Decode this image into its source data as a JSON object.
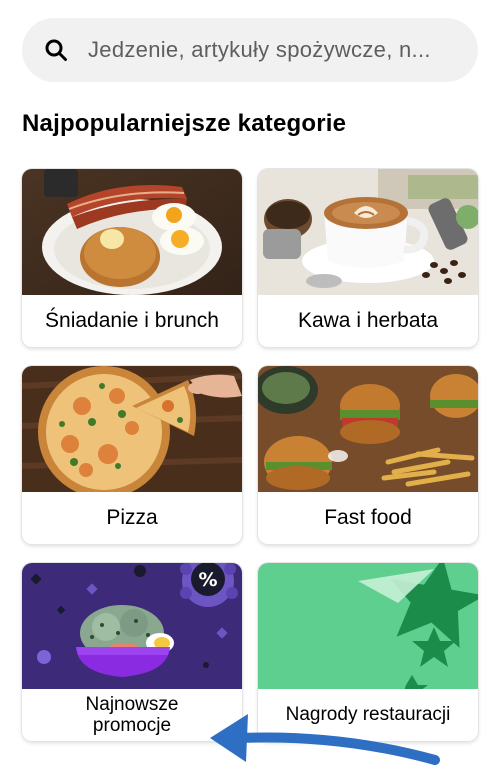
{
  "search": {
    "placeholder": "Jedzenie, artykuły spożywcze, n...",
    "icon": "search-icon"
  },
  "section_title": "Najpopularniejsze kategorie",
  "categories": [
    {
      "label": "Śniadanie i brunch",
      "image": "breakfast-pancakes-eggs-bacon"
    },
    {
      "label": "Kawa i herbata",
      "image": "latte-coffee-cup"
    },
    {
      "label": "Pizza",
      "image": "pizza"
    },
    {
      "label": "Fast food",
      "image": "burgers-fries"
    },
    {
      "label_line1": "Najnowsze",
      "label_line2": "promocje",
      "image": "salad-bowl-with-percent-badge"
    },
    {
      "label": "Nagrody restauracji",
      "image": "green-stars"
    }
  ],
  "colors": {
    "search_bg": "#f1f1f1",
    "promo_bg": "#3d2b7a",
    "rewards_bg": "#5fcf8f",
    "annotation_arrow": "#2e6fc4"
  }
}
